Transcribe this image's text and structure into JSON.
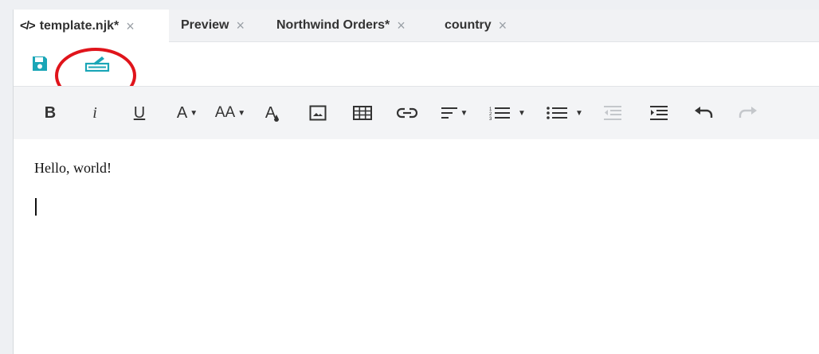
{
  "tabs": [
    {
      "label": "template.njk*",
      "icon": "code-icon",
      "code_glyph": "</>",
      "active": true
    },
    {
      "label": "Preview",
      "active": false
    },
    {
      "label": "Northwind Orders*",
      "active": false
    },
    {
      "label": "country",
      "active": false
    }
  ],
  "tab_close_glyph": "×",
  "actions": {
    "save_icon": "save-icon",
    "edit_icon": "edit-pen-icon",
    "accent_color": "#1aa6b7",
    "highlight_color": "#e0141b"
  },
  "toolbar": {
    "bold": "B",
    "italic": "i",
    "underline": "U",
    "font_color": "A",
    "font_size": "AA",
    "highlight": "A"
  },
  "editor": {
    "text": "Hello, world!"
  }
}
